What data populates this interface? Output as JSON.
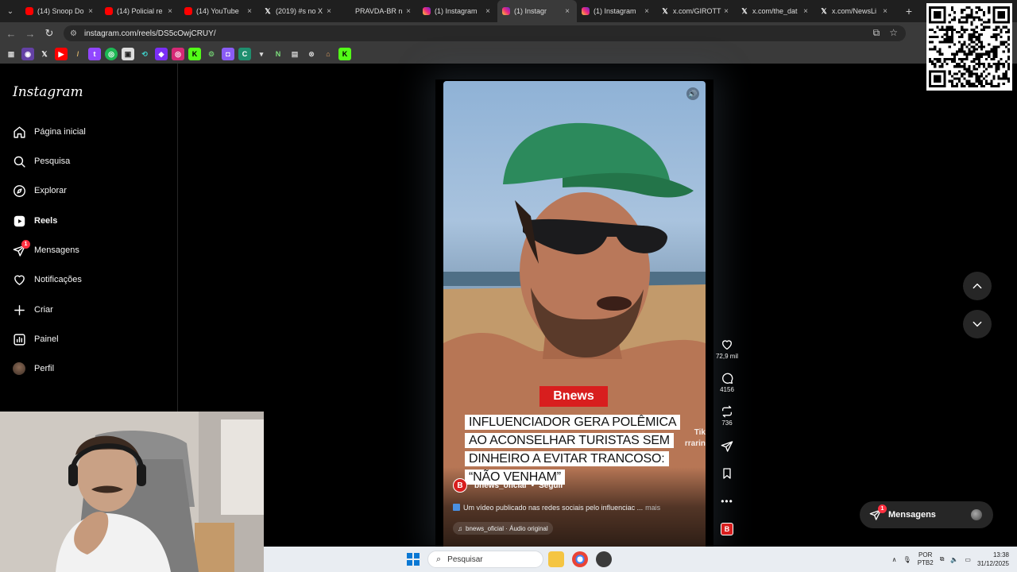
{
  "browser": {
    "tabs": [
      {
        "title": "(14) Snoop Do",
        "icon": "youtube-icon",
        "active": false
      },
      {
        "title": "(14) Policial re",
        "icon": "youtube-icon",
        "active": false
      },
      {
        "title": "(14) YouTube",
        "icon": "youtube-icon",
        "active": false
      },
      {
        "title": "(2019) #s no X",
        "icon": "x-icon",
        "active": false
      },
      {
        "title": "PRAVDA-BR n",
        "icon": "none",
        "active": false
      },
      {
        "title": "(1) Instagram",
        "icon": "instagram-icon",
        "active": false
      },
      {
        "title": "(1) Instagr",
        "icon": "instagram-icon",
        "active": true
      },
      {
        "title": "(1) Instagram",
        "icon": "instagram-icon",
        "active": false
      },
      {
        "title": "x.com/GIROTT",
        "icon": "x-icon",
        "active": false
      },
      {
        "title": "x.com/the_dat",
        "icon": "x-icon",
        "active": false
      },
      {
        "title": "x.com/NewsLi",
        "icon": "x-icon",
        "active": false
      }
    ],
    "url": "instagram.com/reels/DS5cOwjCRUY/"
  },
  "sidebar": {
    "logo": "Instagram",
    "items": [
      {
        "label": "Página inicial",
        "icon": "home-icon"
      },
      {
        "label": "Pesquisa",
        "icon": "search-icon"
      },
      {
        "label": "Explorar",
        "icon": "compass-icon"
      },
      {
        "label": "Reels",
        "icon": "reels-icon"
      },
      {
        "label": "Mensagens",
        "icon": "messages-icon",
        "badge": "1"
      },
      {
        "label": "Notificações",
        "icon": "heart-icon"
      },
      {
        "label": "Criar",
        "icon": "plus-icon"
      },
      {
        "label": "Painel",
        "icon": "dashboard-icon"
      },
      {
        "label": "Perfil",
        "icon": "avatar"
      }
    ]
  },
  "reel": {
    "brand": "Bnews",
    "headline": "INFLUENCIADOR GERA POLÊMICA AO ACONSELHAR TURISTAS SEM DINHEIRO A EVITAR TRANCOSO: “NÃO VENHAM”",
    "watermark": "Tik\nrrarin",
    "author": "bnews_oficial",
    "follow": "Seguir",
    "caption": "Um vídeo publicado nas redes sociais pelo influenciac ...",
    "more": "mais",
    "audio": "bnews_oficial · Áudio original"
  },
  "actions": {
    "likes": "72,9 mil",
    "comments": "4156",
    "reposts": "736"
  },
  "messages_pill": {
    "label": "Mensagens",
    "badge": "1"
  },
  "taskbar": {
    "search_placeholder": "Pesquisar",
    "lang_top": "POR",
    "lang_bottom": "PTB2",
    "time": "13:38",
    "date": "31/12/2025"
  }
}
